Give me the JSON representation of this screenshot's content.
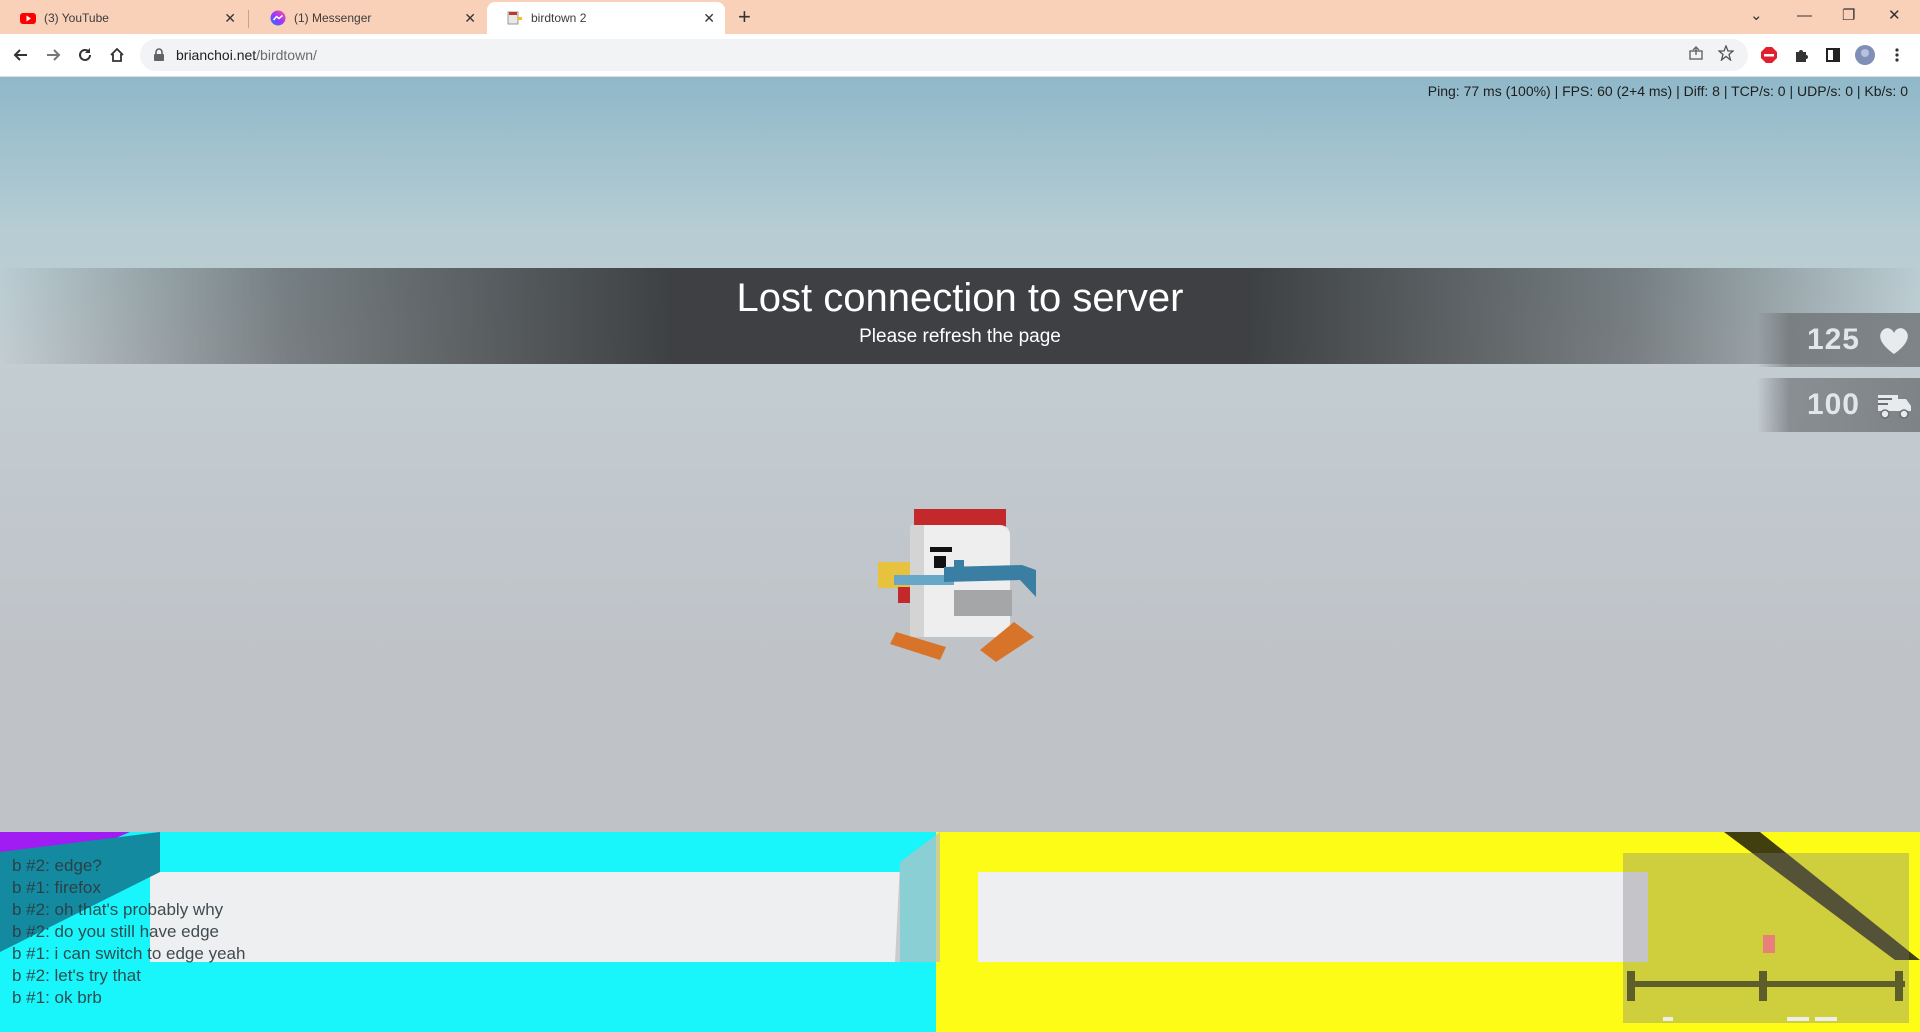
{
  "browser": {
    "tabs": [
      {
        "title": "(3) YouTube",
        "icon": "youtube-icon",
        "active": false
      },
      {
        "title": "(1) Messenger",
        "icon": "messenger-icon",
        "active": false
      },
      {
        "title": "birdtown 2",
        "icon": "birdtown-icon",
        "active": true
      }
    ],
    "new_tab_label": "+",
    "url_host": "brianchoi.net",
    "url_path": "/birdtown/",
    "colors": {
      "tabbar": "#f9d0b8",
      "omnibox": "#f1f3f4"
    }
  },
  "game": {
    "stats": "Ping: 77 ms (100%) | FPS: 60 (2+4 ms) | Diff: 8 | TCP/s: 0 | UDP/s: 0 | Kb/s: 0",
    "banner": {
      "title": "Lost connection to server",
      "subtitle": "Please refresh the page"
    },
    "hud": {
      "health": "125",
      "health_icon": "heart-icon",
      "ammo": "100",
      "ammo_icon": "truck-icon"
    },
    "chat": [
      "b #2: edge?",
      "b #1: firefox",
      "b #2: oh that's probably why",
      "b #2: do you still have edge",
      "b #1: i can switch to edge yeah",
      "b #2: let's try that",
      "b #1: ok brb"
    ],
    "colors": {
      "cyan_floor": "#18f6fb",
      "yellow_floor": "#fdfc17",
      "sky": "#8fb8c9"
    }
  }
}
